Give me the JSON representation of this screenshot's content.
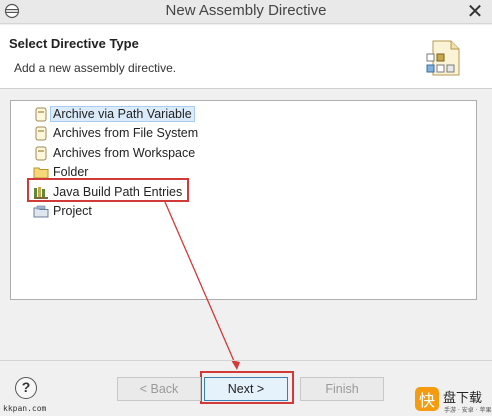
{
  "window": {
    "title": "New Assembly Directive"
  },
  "header": {
    "title": "Select Directive Type",
    "description": "Add a new assembly directive."
  },
  "tree": {
    "items": [
      {
        "label": "Archive via Path Variable",
        "icon": "archive-icon",
        "selected": true
      },
      {
        "label": "Archives from File System",
        "icon": "archive-icon"
      },
      {
        "label": "Archives from Workspace",
        "icon": "archive-icon"
      },
      {
        "label": "Folder",
        "icon": "folder-icon"
      },
      {
        "label": "Java Build Path Entries",
        "icon": "library-icon",
        "highlighted": true
      },
      {
        "label": "Project",
        "icon": "project-icon"
      }
    ]
  },
  "footer": {
    "help_label": "?",
    "back_label": "< Back",
    "next_label": "Next >",
    "finish_label": "Finish"
  },
  "watermark": {
    "site": "kkpan.com",
    "brand": "快盘下载",
    "brand_sub": "手游 · 安卓 · 苹果"
  },
  "colors": {
    "annotation": "#d23a3a",
    "selection": "#dcebfa"
  }
}
